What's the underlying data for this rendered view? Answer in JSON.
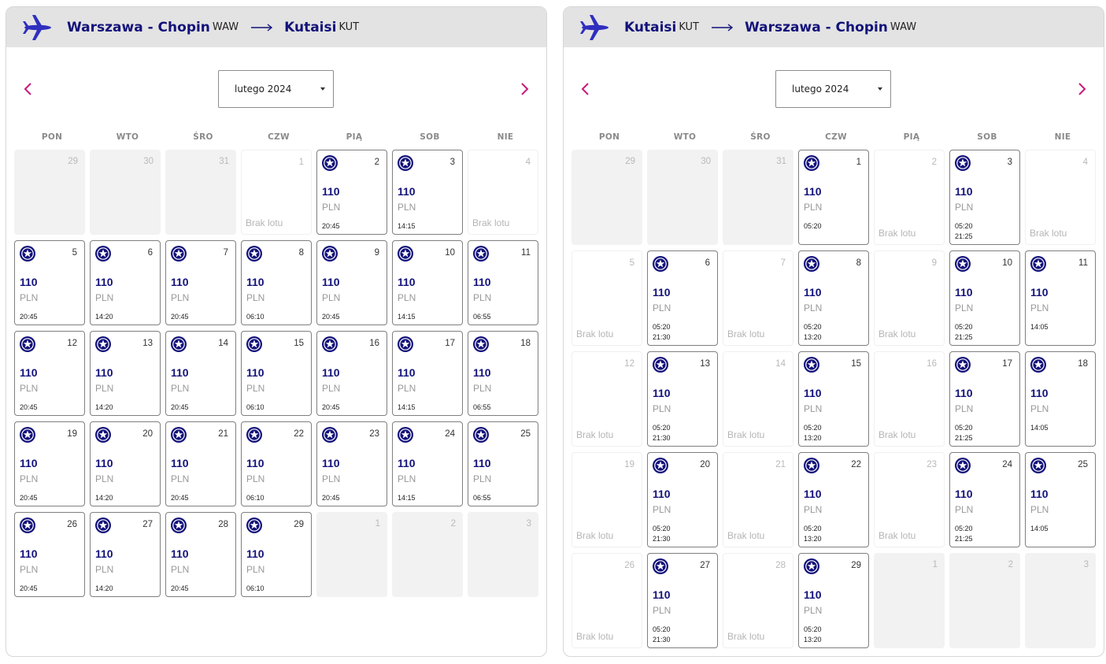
{
  "colors": {
    "brand": "#13127a",
    "accent": "#c7197a",
    "header_bg": "#e3e3e3",
    "muted": "#b9b9b9"
  },
  "panels": [
    {
      "from_city": "Warszawa - Chopin",
      "from_code": "WAW",
      "to_city": "Kutaisi",
      "to_code": "KUT",
      "month_select": "lutego 2024",
      "weekdays": [
        "PON",
        "WTO",
        "ŚRO",
        "CZW",
        "PIĄ",
        "SOB",
        "NIE"
      ],
      "rows": 5,
      "days": [
        {
          "day": "29",
          "state": "off"
        },
        {
          "day": "30",
          "state": "off"
        },
        {
          "day": "31",
          "state": "off"
        },
        {
          "day": "1",
          "state": "none",
          "label": "Brak lotu"
        },
        {
          "day": "2",
          "state": "flight",
          "price": "110",
          "currency": "PLN",
          "times": [
            "20:45"
          ]
        },
        {
          "day": "3",
          "state": "flight",
          "price": "110",
          "currency": "PLN",
          "times": [
            "14:15"
          ]
        },
        {
          "day": "4",
          "state": "none",
          "label": "Brak lotu"
        },
        {
          "day": "5",
          "state": "flight",
          "price": "110",
          "currency": "PLN",
          "times": [
            "20:45"
          ]
        },
        {
          "day": "6",
          "state": "flight",
          "price": "110",
          "currency": "PLN",
          "times": [
            "14:20"
          ]
        },
        {
          "day": "7",
          "state": "flight",
          "price": "110",
          "currency": "PLN",
          "times": [
            "20:45"
          ]
        },
        {
          "day": "8",
          "state": "flight",
          "price": "110",
          "currency": "PLN",
          "times": [
            "06:10"
          ]
        },
        {
          "day": "9",
          "state": "flight",
          "price": "110",
          "currency": "PLN",
          "times": [
            "20:45"
          ]
        },
        {
          "day": "10",
          "state": "flight",
          "price": "110",
          "currency": "PLN",
          "times": [
            "14:15"
          ]
        },
        {
          "day": "11",
          "state": "flight",
          "price": "110",
          "currency": "PLN",
          "times": [
            "06:55"
          ]
        },
        {
          "day": "12",
          "state": "flight",
          "price": "110",
          "currency": "PLN",
          "times": [
            "20:45"
          ]
        },
        {
          "day": "13",
          "state": "flight",
          "price": "110",
          "currency": "PLN",
          "times": [
            "14:20"
          ]
        },
        {
          "day": "14",
          "state": "flight",
          "price": "110",
          "currency": "PLN",
          "times": [
            "20:45"
          ]
        },
        {
          "day": "15",
          "state": "flight",
          "price": "110",
          "currency": "PLN",
          "times": [
            "06:10"
          ]
        },
        {
          "day": "16",
          "state": "flight",
          "price": "110",
          "currency": "PLN",
          "times": [
            "20:45"
          ]
        },
        {
          "day": "17",
          "state": "flight",
          "price": "110",
          "currency": "PLN",
          "times": [
            "14:15"
          ]
        },
        {
          "day": "18",
          "state": "flight",
          "price": "110",
          "currency": "PLN",
          "times": [
            "06:55"
          ]
        },
        {
          "day": "19",
          "state": "flight",
          "price": "110",
          "currency": "PLN",
          "times": [
            "20:45"
          ]
        },
        {
          "day": "20",
          "state": "flight",
          "price": "110",
          "currency": "PLN",
          "times": [
            "14:20"
          ]
        },
        {
          "day": "21",
          "state": "flight",
          "price": "110",
          "currency": "PLN",
          "times": [
            "20:45"
          ]
        },
        {
          "day": "22",
          "state": "flight",
          "price": "110",
          "currency": "PLN",
          "times": [
            "06:10"
          ]
        },
        {
          "day": "23",
          "state": "flight",
          "price": "110",
          "currency": "PLN",
          "times": [
            "20:45"
          ]
        },
        {
          "day": "24",
          "state": "flight",
          "price": "110",
          "currency": "PLN",
          "times": [
            "14:15"
          ]
        },
        {
          "day": "25",
          "state": "flight",
          "price": "110",
          "currency": "PLN",
          "times": [
            "06:55"
          ]
        },
        {
          "day": "26",
          "state": "flight",
          "price": "110",
          "currency": "PLN",
          "times": [
            "20:45"
          ]
        },
        {
          "day": "27",
          "state": "flight",
          "price": "110",
          "currency": "PLN",
          "times": [
            "14:20"
          ]
        },
        {
          "day": "28",
          "state": "flight",
          "price": "110",
          "currency": "PLN",
          "times": [
            "20:45"
          ]
        },
        {
          "day": "29",
          "state": "flight",
          "price": "110",
          "currency": "PLN",
          "times": [
            "06:10"
          ]
        },
        {
          "day": "1",
          "state": "off"
        },
        {
          "day": "2",
          "state": "off"
        },
        {
          "day": "3",
          "state": "off"
        }
      ]
    },
    {
      "from_city": "Kutaisi",
      "from_code": "KUT",
      "to_city": "Warszawa - Chopin",
      "to_code": "WAW",
      "month_select": "lutego 2024",
      "weekdays": [
        "PON",
        "WTO",
        "ŚRO",
        "CZW",
        "PIĄ",
        "SOB",
        "NIE"
      ],
      "rows": 6,
      "days": [
        {
          "day": "29",
          "state": "off"
        },
        {
          "day": "30",
          "state": "off"
        },
        {
          "day": "31",
          "state": "off"
        },
        {
          "day": "1",
          "state": "flight",
          "price": "110",
          "currency": "PLN",
          "times": [
            "05:20"
          ]
        },
        {
          "day": "2",
          "state": "none",
          "label": "Brak lotu"
        },
        {
          "day": "3",
          "state": "flight",
          "price": "110",
          "currency": "PLN",
          "times": [
            "05:20",
            "21:25"
          ]
        },
        {
          "day": "4",
          "state": "none",
          "label": "Brak lotu"
        },
        {
          "day": "5",
          "state": "none",
          "label": "Brak lotu"
        },
        {
          "day": "6",
          "state": "flight",
          "price": "110",
          "currency": "PLN",
          "times": [
            "05:20",
            "21:30"
          ]
        },
        {
          "day": "7",
          "state": "none",
          "label": "Brak lotu"
        },
        {
          "day": "8",
          "state": "flight",
          "price": "110",
          "currency": "PLN",
          "times": [
            "05:20",
            "13:20"
          ]
        },
        {
          "day": "9",
          "state": "none",
          "label": "Brak lotu"
        },
        {
          "day": "10",
          "state": "flight",
          "price": "110",
          "currency": "PLN",
          "times": [
            "05:20",
            "21:25"
          ]
        },
        {
          "day": "11",
          "state": "flight",
          "price": "110",
          "currency": "PLN",
          "times": [
            "14:05"
          ]
        },
        {
          "day": "12",
          "state": "none",
          "label": "Brak lotu"
        },
        {
          "day": "13",
          "state": "flight",
          "price": "110",
          "currency": "PLN",
          "times": [
            "05:20",
            "21:30"
          ]
        },
        {
          "day": "14",
          "state": "none",
          "label": "Brak lotu"
        },
        {
          "day": "15",
          "state": "flight",
          "price": "110",
          "currency": "PLN",
          "times": [
            "05:20",
            "13:20"
          ]
        },
        {
          "day": "16",
          "state": "none",
          "label": "Brak lotu"
        },
        {
          "day": "17",
          "state": "flight",
          "price": "110",
          "currency": "PLN",
          "times": [
            "05:20",
            "21:25"
          ]
        },
        {
          "day": "18",
          "state": "flight",
          "price": "110",
          "currency": "PLN",
          "times": [
            "14:05"
          ]
        },
        {
          "day": "19",
          "state": "none",
          "label": "Brak lotu"
        },
        {
          "day": "20",
          "state": "flight",
          "price": "110",
          "currency": "PLN",
          "times": [
            "05:20",
            "21:30"
          ]
        },
        {
          "day": "21",
          "state": "none",
          "label": "Brak lotu"
        },
        {
          "day": "22",
          "state": "flight",
          "price": "110",
          "currency": "PLN",
          "times": [
            "05:20",
            "13:20"
          ]
        },
        {
          "day": "23",
          "state": "none",
          "label": "Brak lotu"
        },
        {
          "day": "24",
          "state": "flight",
          "price": "110",
          "currency": "PLN",
          "times": [
            "05:20",
            "21:25"
          ]
        },
        {
          "day": "25",
          "state": "flight",
          "price": "110",
          "currency": "PLN",
          "times": [
            "14:05"
          ]
        },
        {
          "day": "26",
          "state": "none",
          "label": "Brak lotu"
        },
        {
          "day": "27",
          "state": "flight",
          "price": "110",
          "currency": "PLN",
          "times": [
            "05:20",
            "21:30"
          ]
        },
        {
          "day": "28",
          "state": "none",
          "label": "Brak lotu"
        },
        {
          "day": "29",
          "state": "flight",
          "price": "110",
          "currency": "PLN",
          "times": [
            "05:20",
            "13:20"
          ]
        },
        {
          "day": "1",
          "state": "off"
        },
        {
          "day": "2",
          "state": "off"
        },
        {
          "day": "3",
          "state": "off"
        }
      ]
    }
  ]
}
